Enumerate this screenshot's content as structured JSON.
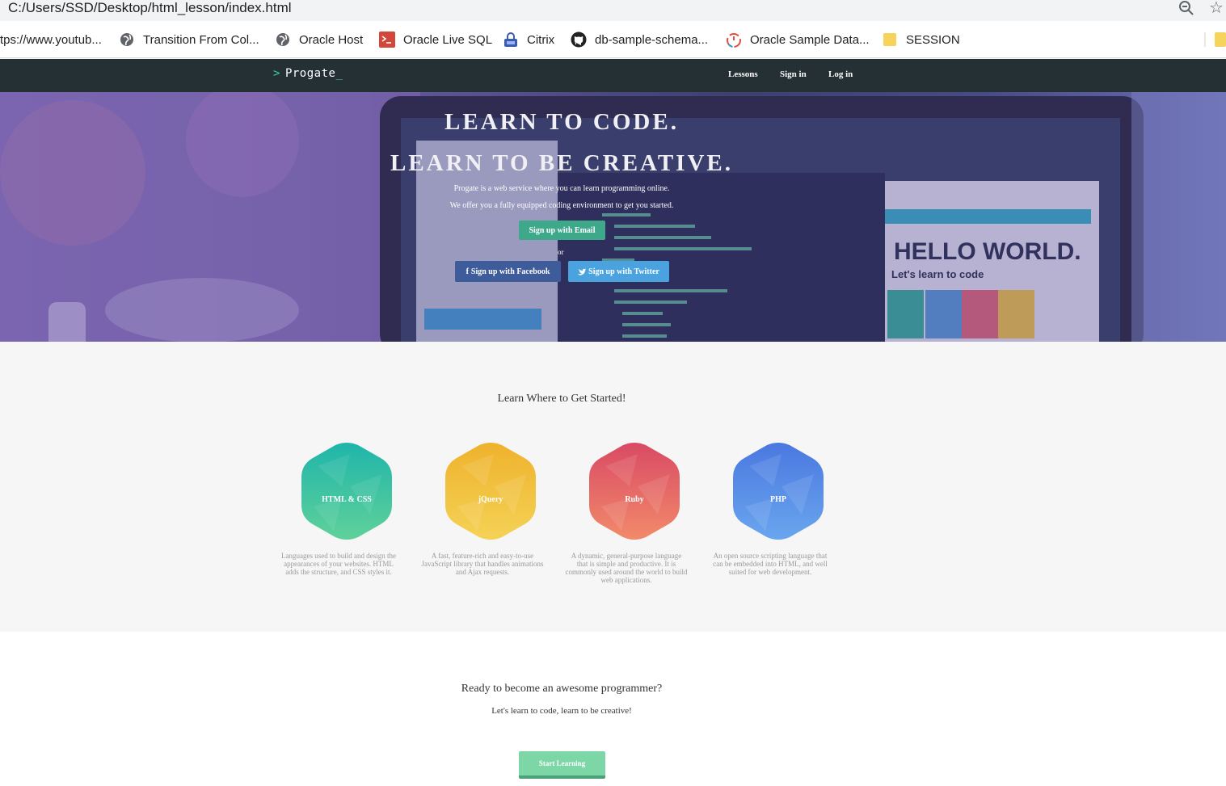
{
  "browser": {
    "address": "C:/Users/SSD/Desktop/html_lesson/index.html",
    "bookmarks": [
      {
        "label": "tps://www.youtub...",
        "icon": "page-icon"
      },
      {
        "label": "Transition From Col...",
        "icon": "globe-icon"
      },
      {
        "label": "Oracle Host",
        "icon": "globe-icon"
      },
      {
        "label": "Oracle Live SQL",
        "icon": "terminal-icon"
      },
      {
        "label": "Citrix",
        "icon": "lock-icon"
      },
      {
        "label": "db-sample-schema...",
        "icon": "github-icon"
      },
      {
        "label": "Oracle Sample Data...",
        "icon": "timer-icon"
      },
      {
        "label": "SESSION",
        "icon": "folder-icon"
      }
    ]
  },
  "nav": {
    "logo": "Progate",
    "links": [
      "Lessons",
      "Sign in",
      "Log in"
    ]
  },
  "hero": {
    "title1": "LEARN TO CODE.",
    "title2": "LEARN TO BE CREATIVE.",
    "desc1": "Progate is a web service where you can learn programming online.",
    "desc2": "We offer you a fully equipped coding environment to get you started.",
    "btn_email": "Sign up with Email",
    "or": "or",
    "btn_facebook": "Sign up with Facebook",
    "btn_twitter": "Sign up with Twitter"
  },
  "start": {
    "title": "Learn Where to Get Started!",
    "langs": [
      {
        "name": "HTML & CSS",
        "desc": "Languages used to build and design the appearances of your websites. HTML adds the structure, and CSS styles it.",
        "color": "#2fbfa4"
      },
      {
        "name": "jQuery",
        "desc": "A fast, feature-rich and easy-to-use JavaScript library that handles animations and Ajax requests.",
        "color": "#f2bd3a"
      },
      {
        "name": "Ruby",
        "desc": "A dynamic, general-purpose language that is simple and productive. It is commonly used around the world to build web applications.",
        "color": "#e8606a"
      },
      {
        "name": "PHP",
        "desc": "An open source scripting language that can be embedded into HTML, and well suited for web development.",
        "color": "#5b8de6"
      }
    ]
  },
  "ready": {
    "title": "Ready to become an awesome programmer?",
    "subtitle": "Let's learn to code, learn to be creative!",
    "button": "Start Learning"
  }
}
